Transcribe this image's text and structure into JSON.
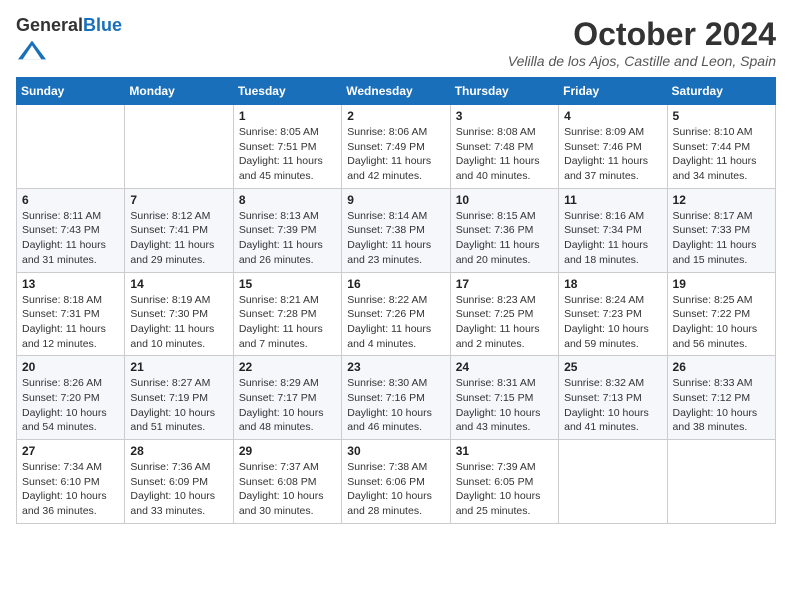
{
  "header": {
    "logo_general": "General",
    "logo_blue": "Blue",
    "month_title": "October 2024",
    "location": "Velilla de los Ajos, Castille and Leon, Spain"
  },
  "days_of_week": [
    "Sunday",
    "Monday",
    "Tuesday",
    "Wednesday",
    "Thursday",
    "Friday",
    "Saturday"
  ],
  "weeks": [
    [
      {
        "day": "",
        "info": ""
      },
      {
        "day": "",
        "info": ""
      },
      {
        "day": "1",
        "info": "Sunrise: 8:05 AM\nSunset: 7:51 PM\nDaylight: 11 hours and 45 minutes."
      },
      {
        "day": "2",
        "info": "Sunrise: 8:06 AM\nSunset: 7:49 PM\nDaylight: 11 hours and 42 minutes."
      },
      {
        "day": "3",
        "info": "Sunrise: 8:08 AM\nSunset: 7:48 PM\nDaylight: 11 hours and 40 minutes."
      },
      {
        "day": "4",
        "info": "Sunrise: 8:09 AM\nSunset: 7:46 PM\nDaylight: 11 hours and 37 minutes."
      },
      {
        "day": "5",
        "info": "Sunrise: 8:10 AM\nSunset: 7:44 PM\nDaylight: 11 hours and 34 minutes."
      }
    ],
    [
      {
        "day": "6",
        "info": "Sunrise: 8:11 AM\nSunset: 7:43 PM\nDaylight: 11 hours and 31 minutes."
      },
      {
        "day": "7",
        "info": "Sunrise: 8:12 AM\nSunset: 7:41 PM\nDaylight: 11 hours and 29 minutes."
      },
      {
        "day": "8",
        "info": "Sunrise: 8:13 AM\nSunset: 7:39 PM\nDaylight: 11 hours and 26 minutes."
      },
      {
        "day": "9",
        "info": "Sunrise: 8:14 AM\nSunset: 7:38 PM\nDaylight: 11 hours and 23 minutes."
      },
      {
        "day": "10",
        "info": "Sunrise: 8:15 AM\nSunset: 7:36 PM\nDaylight: 11 hours and 20 minutes."
      },
      {
        "day": "11",
        "info": "Sunrise: 8:16 AM\nSunset: 7:34 PM\nDaylight: 11 hours and 18 minutes."
      },
      {
        "day": "12",
        "info": "Sunrise: 8:17 AM\nSunset: 7:33 PM\nDaylight: 11 hours and 15 minutes."
      }
    ],
    [
      {
        "day": "13",
        "info": "Sunrise: 8:18 AM\nSunset: 7:31 PM\nDaylight: 11 hours and 12 minutes."
      },
      {
        "day": "14",
        "info": "Sunrise: 8:19 AM\nSunset: 7:30 PM\nDaylight: 11 hours and 10 minutes."
      },
      {
        "day": "15",
        "info": "Sunrise: 8:21 AM\nSunset: 7:28 PM\nDaylight: 11 hours and 7 minutes."
      },
      {
        "day": "16",
        "info": "Sunrise: 8:22 AM\nSunset: 7:26 PM\nDaylight: 11 hours and 4 minutes."
      },
      {
        "day": "17",
        "info": "Sunrise: 8:23 AM\nSunset: 7:25 PM\nDaylight: 11 hours and 2 minutes."
      },
      {
        "day": "18",
        "info": "Sunrise: 8:24 AM\nSunset: 7:23 PM\nDaylight: 10 hours and 59 minutes."
      },
      {
        "day": "19",
        "info": "Sunrise: 8:25 AM\nSunset: 7:22 PM\nDaylight: 10 hours and 56 minutes."
      }
    ],
    [
      {
        "day": "20",
        "info": "Sunrise: 8:26 AM\nSunset: 7:20 PM\nDaylight: 10 hours and 54 minutes."
      },
      {
        "day": "21",
        "info": "Sunrise: 8:27 AM\nSunset: 7:19 PM\nDaylight: 10 hours and 51 minutes."
      },
      {
        "day": "22",
        "info": "Sunrise: 8:29 AM\nSunset: 7:17 PM\nDaylight: 10 hours and 48 minutes."
      },
      {
        "day": "23",
        "info": "Sunrise: 8:30 AM\nSunset: 7:16 PM\nDaylight: 10 hours and 46 minutes."
      },
      {
        "day": "24",
        "info": "Sunrise: 8:31 AM\nSunset: 7:15 PM\nDaylight: 10 hours and 43 minutes."
      },
      {
        "day": "25",
        "info": "Sunrise: 8:32 AM\nSunset: 7:13 PM\nDaylight: 10 hours and 41 minutes."
      },
      {
        "day": "26",
        "info": "Sunrise: 8:33 AM\nSunset: 7:12 PM\nDaylight: 10 hours and 38 minutes."
      }
    ],
    [
      {
        "day": "27",
        "info": "Sunrise: 7:34 AM\nSunset: 6:10 PM\nDaylight: 10 hours and 36 minutes."
      },
      {
        "day": "28",
        "info": "Sunrise: 7:36 AM\nSunset: 6:09 PM\nDaylight: 10 hours and 33 minutes."
      },
      {
        "day": "29",
        "info": "Sunrise: 7:37 AM\nSunset: 6:08 PM\nDaylight: 10 hours and 30 minutes."
      },
      {
        "day": "30",
        "info": "Sunrise: 7:38 AM\nSunset: 6:06 PM\nDaylight: 10 hours and 28 minutes."
      },
      {
        "day": "31",
        "info": "Sunrise: 7:39 AM\nSunset: 6:05 PM\nDaylight: 10 hours and 25 minutes."
      },
      {
        "day": "",
        "info": ""
      },
      {
        "day": "",
        "info": ""
      }
    ]
  ]
}
